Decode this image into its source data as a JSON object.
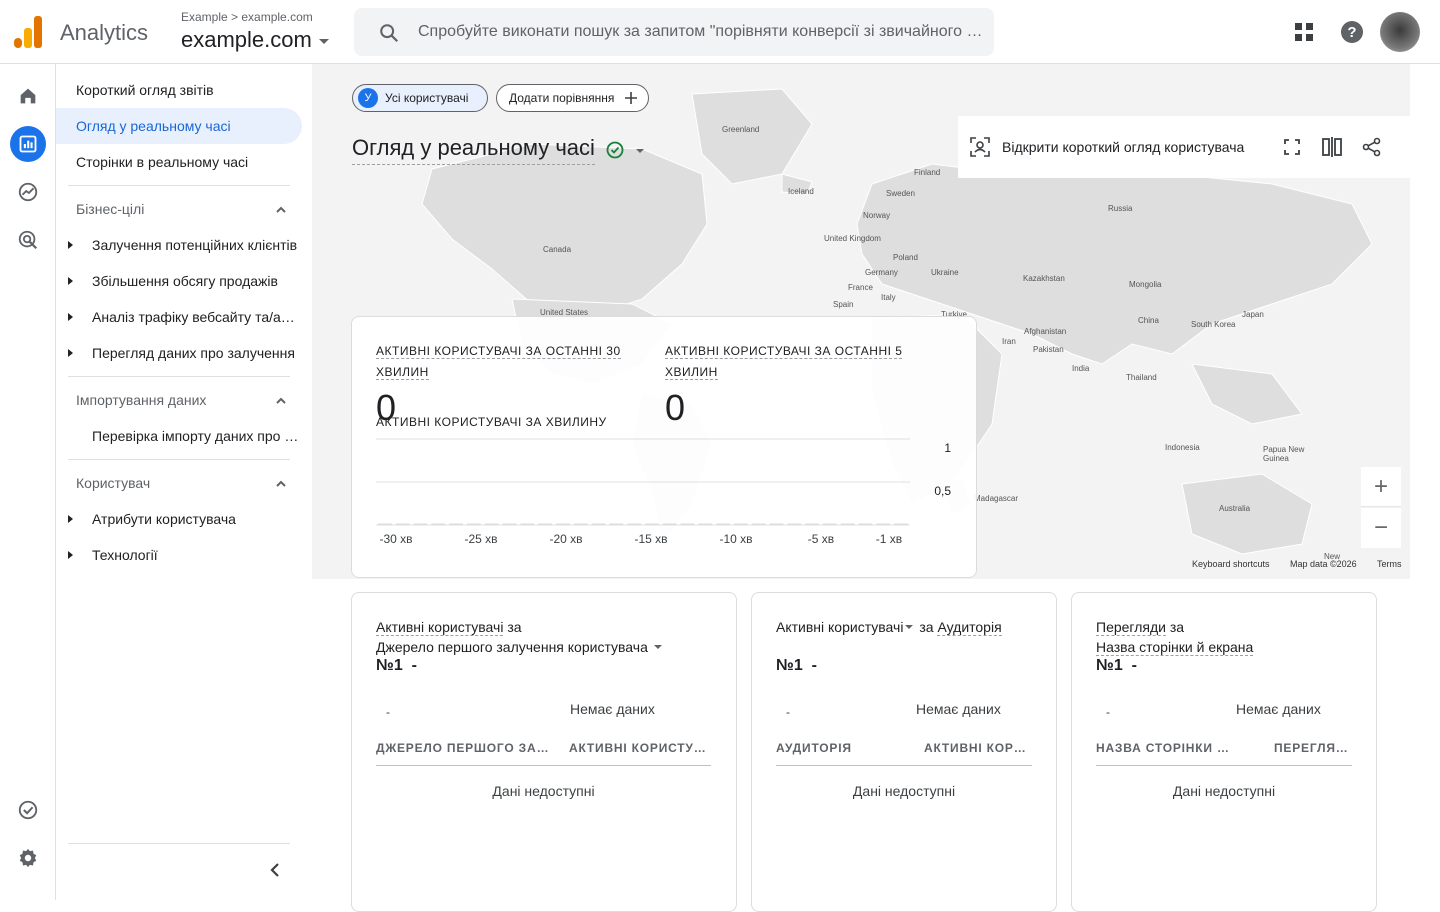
{
  "header": {
    "app_name": "Analytics",
    "breadcrumb_account": "Example",
    "breadcrumb_property": "example.com",
    "property_name": "example.com",
    "search_placeholder": "Спробуйте виконати пошук за запитом \"порівняти конверсії зі звичайного пошуку\""
  },
  "nav": {
    "items": [
      {
        "label": "Короткий огляд звітів"
      },
      {
        "label": "Огляд у реальному часі"
      },
      {
        "label": "Сторінки в реальному часі"
      }
    ],
    "sections": [
      {
        "title": "Бізнес-цілі",
        "items": [
          "Залучення потенційних клієнтів",
          "Збільшення обсягу продажів",
          "Аналіз трафіку вебсайту та/або додатка",
          "Перегляд даних про залучення"
        ]
      },
      {
        "title": "Імпортування даних",
        "items": [
          "Перевірка імпорту даних про витрати"
        ]
      },
      {
        "title": "Користувач",
        "items": [
          "Атрибути користувача",
          "Технології"
        ]
      }
    ]
  },
  "chips": {
    "audience_letter": "У",
    "audience_label": "Усі користувачі",
    "add_comparison": "Додати порівняння"
  },
  "page": {
    "title": "Огляд у реальному часі",
    "open_user_snapshot": "Відкрити короткий огляд користувача"
  },
  "map": {
    "labels": [
      "Greenland",
      "Iceland",
      "Finland",
      "Sweden",
      "Norway",
      "Russia",
      "United Kingdom",
      "Poland",
      "Germany",
      "Ukraine",
      "Kazakhstan",
      "France",
      "Italy",
      "Spain",
      "Turkiye",
      "Mongolia",
      "Canada",
      "United States",
      "Afghanistan",
      "Iran",
      "Pakistan",
      "China",
      "South Korea",
      "Japan",
      "India",
      "Thailand",
      "Indonesia",
      "Papua New Guinea",
      "Australia",
      "Madagascar",
      "New"
    ],
    "footer_keyboard": "Keyboard shortcuts",
    "footer_data": "Map data ©2026",
    "footer_terms": "Terms",
    "zoom_in": "+",
    "zoom_out": "−"
  },
  "metrics": {
    "label_30": "АКТИВНІ КОРИСТУВАЧІ ЗА ОСТАННІ 30 ХВИЛИН",
    "value_30": "0",
    "label_5": "АКТИВНІ КОРИСТУВАЧІ ЗА ОСТАННІ 5 ХВИЛИН",
    "value_5": "0",
    "chart_title": "АКТИВНІ КОРИСТУВАЧІ ЗА ХВИЛИНУ"
  },
  "chart_data": {
    "type": "bar",
    "title": "АКТИВНІ КОРИСТУВАЧІ ЗА ХВИЛИНУ",
    "categories": [
      "-30 хв",
      "-25 хв",
      "-20 хв",
      "-15 хв",
      "-10 хв",
      "-5 хв",
      "-1 хв"
    ],
    "values": [
      0,
      0,
      0,
      0,
      0,
      0,
      0
    ],
    "y_ticks": [
      "1",
      "0,5"
    ],
    "ylim": [
      0,
      1
    ]
  },
  "cards": [
    {
      "head_metric": "Активні користувачі",
      "head_by": "за",
      "head_dimension": "Джерело першого залучення користувача",
      "rank": "№1",
      "rank_dash": "-",
      "no_data": "Немає даних",
      "dash": "-",
      "col1": "ДЖЕРЕЛО ПЕРШОГО ЗАЛУЧЕННЯ",
      "col2": "АКТИВНІ КОРИСТУВАЧІ",
      "unavailable": "Дані недоступні"
    },
    {
      "head_metric": "Активні користувачі",
      "head_by": "за",
      "head_dimension": "Аудиторія",
      "rank": "№1",
      "rank_dash": "-",
      "no_data": "Немає даних",
      "dash": "-",
      "col1": "АУДИТОРІЯ",
      "col2": "АКТИВНІ КОРИСТУВАЧІ",
      "unavailable": "Дані недоступні"
    },
    {
      "head_metric": "Перегляди",
      "head_by": "за",
      "head_dimension": "Назва сторінки й екрана",
      "rank": "№1",
      "rank_dash": "-",
      "no_data": "Немає даних",
      "dash": "-",
      "col1": "НАЗВА СТОРІНКИ Й ЕКРАНА",
      "col2": "ПЕРЕГЛЯДИ",
      "unavailable": "Дані недоступні"
    }
  ],
  "colors": {
    "accent": "#1a73e8",
    "logo_orange": "#f9ab00",
    "logo_dark": "#e37400",
    "check_green": "#188038"
  }
}
